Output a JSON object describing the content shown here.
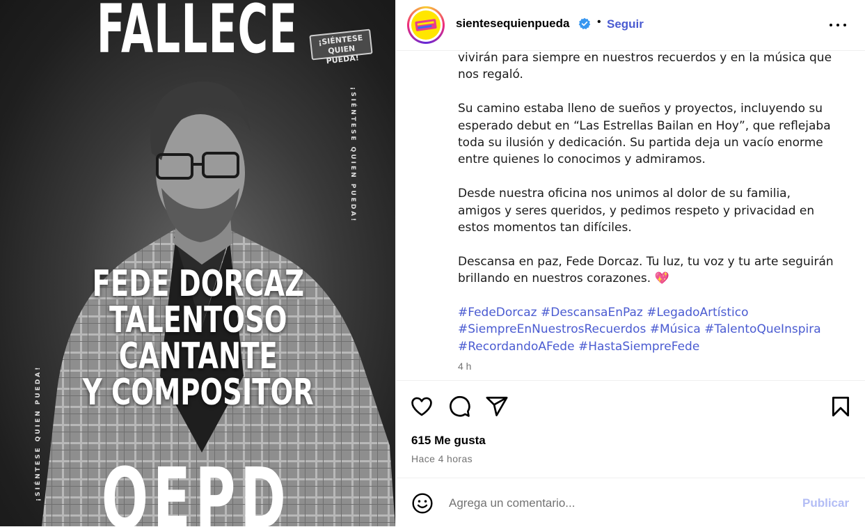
{
  "post_image": {
    "headline_top": "FALLECE",
    "name_lines": [
      "FEDE DORCAZ",
      "TALENTOSO CANTANTE",
      "Y COMPOSITOR"
    ],
    "headline_bottom": "QEPD",
    "brand_stamp_line1": "¡SIÉNTESE",
    "brand_stamp_line2": "QUIEN PUEDA!",
    "vertical_watermark": "¡SIÉNTESE QUIEN PUEDA!"
  },
  "header": {
    "username": "sientesequienpueda",
    "verified_icon": "verified-badge-icon",
    "separator": "•",
    "follow_label": "Seguir",
    "more_icon": "more-options-icon"
  },
  "caption": {
    "paragraphs": [
      "vivirán para siempre en nuestros recuerdos y en la música que nos regaló.",
      "Su camino estaba lleno de sueños y proyectos, incluyendo su esperado debut en “Las Estrellas Bailan en Hoy”, que reflejaba toda su ilusión y dedicación. Su partida deja un vacío enorme entre quienes lo conocimos y admiramos.",
      "Desde nuestra oficina nos unimos al dolor de su familia, amigos y seres queridos, y pedimos respeto y privacidad en estos momentos tan difíciles.",
      "Descansa en paz, Fede Dorcaz. Tu luz, tu voz y tu arte seguirán brillando en nuestros corazones."
    ],
    "heart_emoji": "💖",
    "hashtags": [
      "#FedeDorcaz",
      "#DescansaEnPaz",
      "#LegadoArtístico",
      "#SiempreEnNuestrosRecuerdos",
      "#Música",
      "#TalentoQueInspira",
      "#RecordandoAFede",
      "#HastaSiempreFede"
    ],
    "time": "4 h"
  },
  "actions": {
    "icons": [
      "heart-icon",
      "comment-icon",
      "share-icon",
      "bookmark-icon"
    ],
    "likes": "615 Me gusta",
    "posted_ago": "Hace 4 horas"
  },
  "comment": {
    "placeholder": "Agrega un comentario...",
    "publish_label": "Publicar",
    "emoji_icon": "emoji-icon"
  },
  "colors": {
    "accent": "#4a5bd1",
    "publish_disabled": "#b3bdf5",
    "muted": "#737373",
    "verified": "#3897f0"
  }
}
